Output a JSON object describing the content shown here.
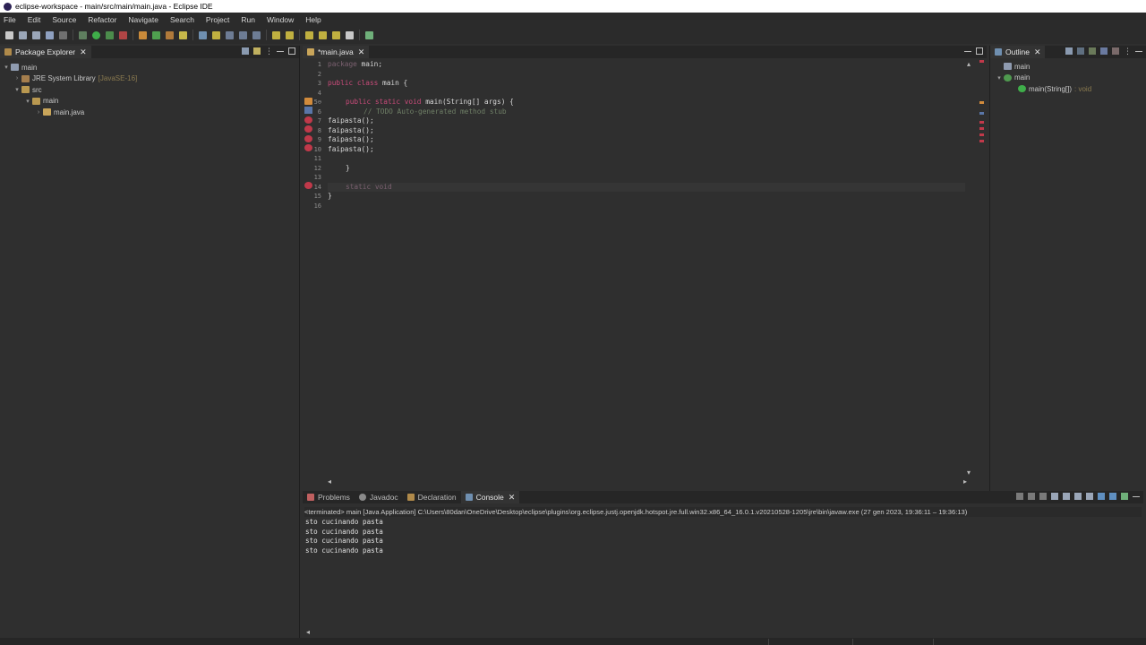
{
  "window": {
    "title": "eclipse-workspace - main/src/main/main.java - Eclipse IDE"
  },
  "menu": [
    "File",
    "Edit",
    "Source",
    "Refactor",
    "Navigate",
    "Search",
    "Project",
    "Run",
    "Window",
    "Help"
  ],
  "package_explorer": {
    "tab_label": "Package Explorer",
    "tree": [
      {
        "label": "main",
        "suffix": ""
      },
      {
        "label": "JRE System Library",
        "suffix": "[JavaSE-16]"
      },
      {
        "label": "src",
        "suffix": ""
      },
      {
        "label": "main",
        "suffix": ""
      },
      {
        "label": "main.java",
        "suffix": ""
      }
    ]
  },
  "editor": {
    "tab_label": "*main.java",
    "line_numbers": [
      "1",
      "2",
      "3",
      "4",
      "5⊖",
      "6",
      "7",
      "8",
      "9",
      "10",
      "11",
      "12",
      "13",
      "14",
      "15",
      "16"
    ],
    "lines": {
      "l1_kw": "package",
      "l1_rest": " main;",
      "l3_kw": "public class",
      "l3_rest": " main {",
      "l5_kw": "public static void",
      "l5_rest": " main(String[] args) {",
      "l6": "// TODO Auto-generated method stub",
      "l7": "faipasta();",
      "l8": "faipasta();",
      "l9": "faipasta();",
      "l10": "faipasta();",
      "l12": "}",
      "l14": "static void",
      "l15": "}"
    }
  },
  "outline": {
    "tab_label": "Outline",
    "tree": [
      {
        "label": "main",
        "suffix": ""
      },
      {
        "label": "main",
        "suffix": ""
      },
      {
        "label": "main(String[])",
        "suffix": ": void"
      }
    ]
  },
  "console": {
    "tabs": [
      "Problems",
      "Javadoc",
      "Declaration",
      "Console"
    ],
    "header": "<terminated> main [Java Application] C:\\Users\\80dan\\OneDrive\\Desktop\\eclipse\\plugins\\org.eclipse.justj.openjdk.hotspot.jre.full.win32.x86_64_16.0.1.v20210528-1205\\jre\\bin\\javaw.exe  (27 gen 2023, 19:36:11 – 19:36:13)",
    "output": [
      "sto cucinando pasta",
      "sto cucinando pasta",
      "sto cucinando pasta",
      "sto cucinando pasta"
    ]
  },
  "colors": {
    "background": "#2f2f2f",
    "keyword": "#c94b7a",
    "comment": "#6f7f66",
    "error": "#c0394a",
    "warning": "#d28b3c"
  }
}
